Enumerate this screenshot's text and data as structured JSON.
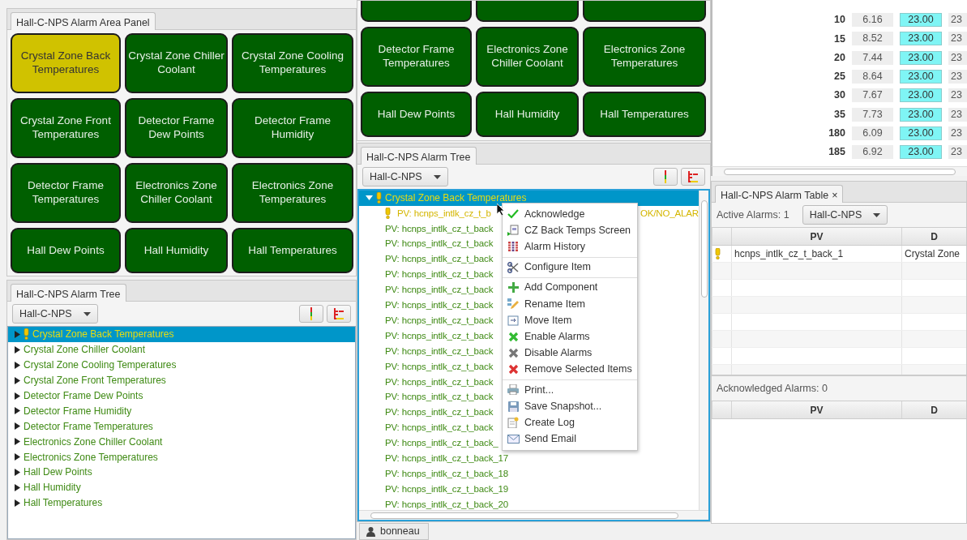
{
  "area_panel": {
    "tab": "Hall-C-NPS Alarm Area Panel",
    "buttons": [
      {
        "label": "Crystal Zone Back Temperatures",
        "alarm": true
      },
      {
        "label": "Crystal Zone Chiller Coolant",
        "alarm": false
      },
      {
        "label": "Crystal Zone Cooling Temperatures",
        "alarm": false
      },
      {
        "label": "Crystal Zone Front Temperatures",
        "alarm": false
      },
      {
        "label": "Detector Frame Dew Points",
        "alarm": false
      },
      {
        "label": "Detector Frame Humidity",
        "alarm": false
      },
      {
        "label": "Detector Frame Temperatures",
        "alarm": false
      },
      {
        "label": "Electronics Zone Chiller Coolant",
        "alarm": false
      },
      {
        "label": "Electronics Zone Temperatures",
        "alarm": false
      },
      {
        "label": "Hall Dew Points",
        "alarm": false
      },
      {
        "label": "Hall Humidity",
        "alarm": false
      },
      {
        "label": "Hall Temperatures",
        "alarm": false
      }
    ]
  },
  "area_panel_scrolled": {
    "buttons": [
      {
        "label": "Detector Frame Temperatures",
        "alarm": false
      },
      {
        "label": "Electronics Zone Chiller Coolant",
        "alarm": false
      },
      {
        "label": "Electronics Zone Temperatures",
        "alarm": false
      },
      {
        "label": "Hall Dew Points",
        "alarm": false
      },
      {
        "label": "Hall Humidity",
        "alarm": false
      },
      {
        "label": "Hall Temperatures",
        "alarm": false
      }
    ]
  },
  "tree_left": {
    "tab": "Hall-C-NPS Alarm Tree",
    "filter": "Hall-C-NPS",
    "items": [
      {
        "label": "Crystal Zone Back Temperatures",
        "alarm": true,
        "selected": true,
        "expanded": false
      },
      {
        "label": "Crystal Zone Chiller Coolant",
        "alarm": false,
        "selected": false,
        "expanded": false
      },
      {
        "label": "Crystal Zone Cooling Temperatures",
        "alarm": false,
        "selected": false,
        "expanded": false
      },
      {
        "label": "Crystal Zone Front Temperatures",
        "alarm": false,
        "selected": false,
        "expanded": false
      },
      {
        "label": "Detector Frame Dew Points",
        "alarm": false,
        "selected": false,
        "expanded": false
      },
      {
        "label": "Detector Frame Humidity",
        "alarm": false,
        "selected": false,
        "expanded": false
      },
      {
        "label": "Detector Frame Temperatures",
        "alarm": false,
        "selected": false,
        "expanded": false
      },
      {
        "label": "Electronics Zone Chiller Coolant",
        "alarm": false,
        "selected": false,
        "expanded": false
      },
      {
        "label": "Electronics Zone Temperatures",
        "alarm": false,
        "selected": false,
        "expanded": false
      },
      {
        "label": "Hall Dew Points",
        "alarm": false,
        "selected": false,
        "expanded": false
      },
      {
        "label": "Hall Humidity",
        "alarm": false,
        "selected": false,
        "expanded": false
      },
      {
        "label": "Hall Temperatures",
        "alarm": false,
        "selected": false,
        "expanded": false
      }
    ]
  },
  "tree_middle": {
    "tab": "Hall-C-NPS Alarm Tree",
    "filter": "Hall-C-NPS",
    "items": [
      {
        "label": "Crystal Zone Back Temperatures",
        "alarm": true,
        "selected": true,
        "expanded": true,
        "children": [
          {
            "label": "PV: hcnps_intlk_cz_t_b",
            "alarm": true,
            "status": "OK/NO_ALAR"
          },
          {
            "label": "PV: hcnps_intlk_cz_t_back",
            "alarm": false
          },
          {
            "label": "PV: hcnps_intlk_cz_t_back",
            "alarm": false
          },
          {
            "label": "PV: hcnps_intlk_cz_t_back",
            "alarm": false
          },
          {
            "label": "PV: hcnps_intlk_cz_t_back",
            "alarm": false
          },
          {
            "label": "PV: hcnps_intlk_cz_t_back",
            "alarm": false
          },
          {
            "label": "PV: hcnps_intlk_cz_t_back",
            "alarm": false
          },
          {
            "label": "PV: hcnps_intlk_cz_t_back",
            "alarm": false
          },
          {
            "label": "PV: hcnps_intlk_cz_t_back",
            "alarm": false
          },
          {
            "label": "PV: hcnps_intlk_cz_t_back",
            "alarm": false
          },
          {
            "label": "PV: hcnps_intlk_cz_t_back",
            "alarm": false
          },
          {
            "label": "PV: hcnps_intlk_cz_t_back",
            "alarm": false
          },
          {
            "label": "PV: hcnps_intlk_cz_t_back",
            "alarm": false
          },
          {
            "label": "PV: hcnps_intlk_cz_t_back",
            "alarm": false
          },
          {
            "label": "PV: hcnps_intlk_cz_t_back",
            "alarm": false
          },
          {
            "label": "PV: hcnps_intlk_cz_t_back_",
            "alarm": false
          },
          {
            "label": "PV: hcnps_intlk_cz_t_back_17",
            "alarm": false
          },
          {
            "label": "PV: hcnps_intlk_cz_t_back_18",
            "alarm": false
          },
          {
            "label": "PV: hcnps_intlk_cz_t_back_19",
            "alarm": false
          },
          {
            "label": "PV: hcnps_intlk_cz_t_back_20",
            "alarm": false
          }
        ]
      }
    ]
  },
  "context_menu": {
    "groups": [
      [
        {
          "label": "Acknowledge"
        },
        {
          "label": "CZ Back Temps Screen"
        },
        {
          "label": "Alarm History"
        }
      ],
      [
        {
          "label": "Configure Item"
        }
      ],
      [
        {
          "label": "Add Component"
        },
        {
          "label": "Rename Item"
        },
        {
          "label": "Move Item"
        },
        {
          "label": "Enable Alarms"
        },
        {
          "label": "Disable Alarms"
        },
        {
          "label": "Remove Selected Items"
        }
      ],
      [
        {
          "label": "Print..."
        },
        {
          "label": "Save Snapshot..."
        },
        {
          "label": "Create Log"
        },
        {
          "label": "Send Email"
        }
      ]
    ]
  },
  "data_table": {
    "rows": [
      {
        "label": "10",
        "cells": [
          {
            "text": "6.16",
            "highlighted": false
          },
          {
            "text": "23.00",
            "highlighted": true
          },
          {
            "text": "23",
            "highlighted": false
          }
        ]
      },
      {
        "label": "15",
        "cells": [
          {
            "text": "8.52",
            "highlighted": false
          },
          {
            "text": "23.00",
            "highlighted": true
          },
          {
            "text": "23",
            "highlighted": false
          }
        ]
      },
      {
        "label": "20",
        "cells": [
          {
            "text": "7.44",
            "highlighted": false
          },
          {
            "text": "23.00",
            "highlighted": true
          },
          {
            "text": "23",
            "highlighted": false
          }
        ]
      },
      {
        "label": "25",
        "cells": [
          {
            "text": "8.64",
            "highlighted": false
          },
          {
            "text": "23.00",
            "highlighted": true
          },
          {
            "text": "23",
            "highlighted": false
          }
        ]
      },
      {
        "label": "30",
        "cells": [
          {
            "text": "7.67",
            "highlighted": false
          },
          {
            "text": "23.00",
            "highlighted": true
          },
          {
            "text": "23",
            "highlighted": false
          }
        ]
      },
      {
        "label": "35",
        "cells": [
          {
            "text": "7.73",
            "highlighted": false
          },
          {
            "text": "23.00",
            "highlighted": true
          },
          {
            "text": "23",
            "highlighted": false
          }
        ]
      },
      {
        "label": "180",
        "cells": [
          {
            "text": "6.09",
            "highlighted": false
          },
          {
            "text": "23.00",
            "highlighted": true
          },
          {
            "text": "23",
            "highlighted": false
          }
        ]
      },
      {
        "label": "185",
        "cells": [
          {
            "text": "6.92",
            "highlighted": false
          },
          {
            "text": "23.00",
            "highlighted": true
          },
          {
            "text": "23",
            "highlighted": false
          }
        ]
      }
    ]
  },
  "alarm_table": {
    "tab": "Hall-C-NPS Alarm Table",
    "close": "×",
    "active_label": "Active Alarms: 1",
    "filter": "Hall-C-NPS",
    "columns": [
      "PV",
      "D"
    ],
    "rows": [
      {
        "alarm": true,
        "pv": "hcnps_intlk_cz_t_back_1",
        "description": "Crystal Zone"
      }
    ],
    "acknowledged_label": "Acknowledged Alarms: 0",
    "acknowledged_columns": [
      "PV",
      "D"
    ]
  },
  "status_bar": {
    "user": "bonneau"
  }
}
